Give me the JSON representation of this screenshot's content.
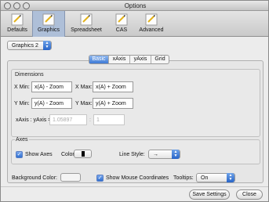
{
  "window": {
    "title": "Options"
  },
  "toolbar": {
    "items": [
      {
        "label": "Defaults",
        "icon": "defaults-icon"
      },
      {
        "label": "Graphics",
        "icon": "graphics-icon"
      },
      {
        "label": "Spreadsheet",
        "icon": "spreadsheet-icon"
      },
      {
        "label": "CAS",
        "icon": "cas-icon"
      },
      {
        "label": "Advanced",
        "icon": "advanced-icon"
      }
    ],
    "active": "Graphics"
  },
  "view_select": {
    "value": "Graphics 2"
  },
  "tabs": [
    "Basic",
    "xAxis",
    "yAxis",
    "Grid"
  ],
  "active_tab": "Basic",
  "dimensions": {
    "title": "Dimensions",
    "x_min_label": "X Min:",
    "x_min_value": "x(A) - Zoom",
    "x_max_label": "X Max:",
    "x_max_value": "x(A) + Zoom",
    "y_min_label": "Y Min:",
    "y_min_value": "y(A) - Zoom",
    "y_max_label": "Y Max:",
    "y_max_value": "y(A) + Zoom",
    "ratio_label": "xAxis : yAxis =",
    "ratio_x": "1.05897",
    "ratio_sep": ":",
    "ratio_y": "1"
  },
  "axes": {
    "title": "Axes",
    "show_axes_label": "Show Axes",
    "show_axes_checked": true,
    "color_label": "Color:",
    "axis_color": "#000000",
    "line_style_label": "Line Style:",
    "line_style_value": "→"
  },
  "bottom": {
    "background_label": "Background Color:",
    "background_color": "#ffffff",
    "mouse_coords_label": "Show Mouse Coordinates",
    "mouse_coords_checked": true,
    "tooltips_label": "Tooltips:",
    "tooltips_value": "On"
  },
  "footer": {
    "save_label": "Save Settings",
    "close_label": "Close"
  },
  "colors": {
    "accent": "#2f6fd0",
    "active_toolbar": "#aebfd8"
  }
}
